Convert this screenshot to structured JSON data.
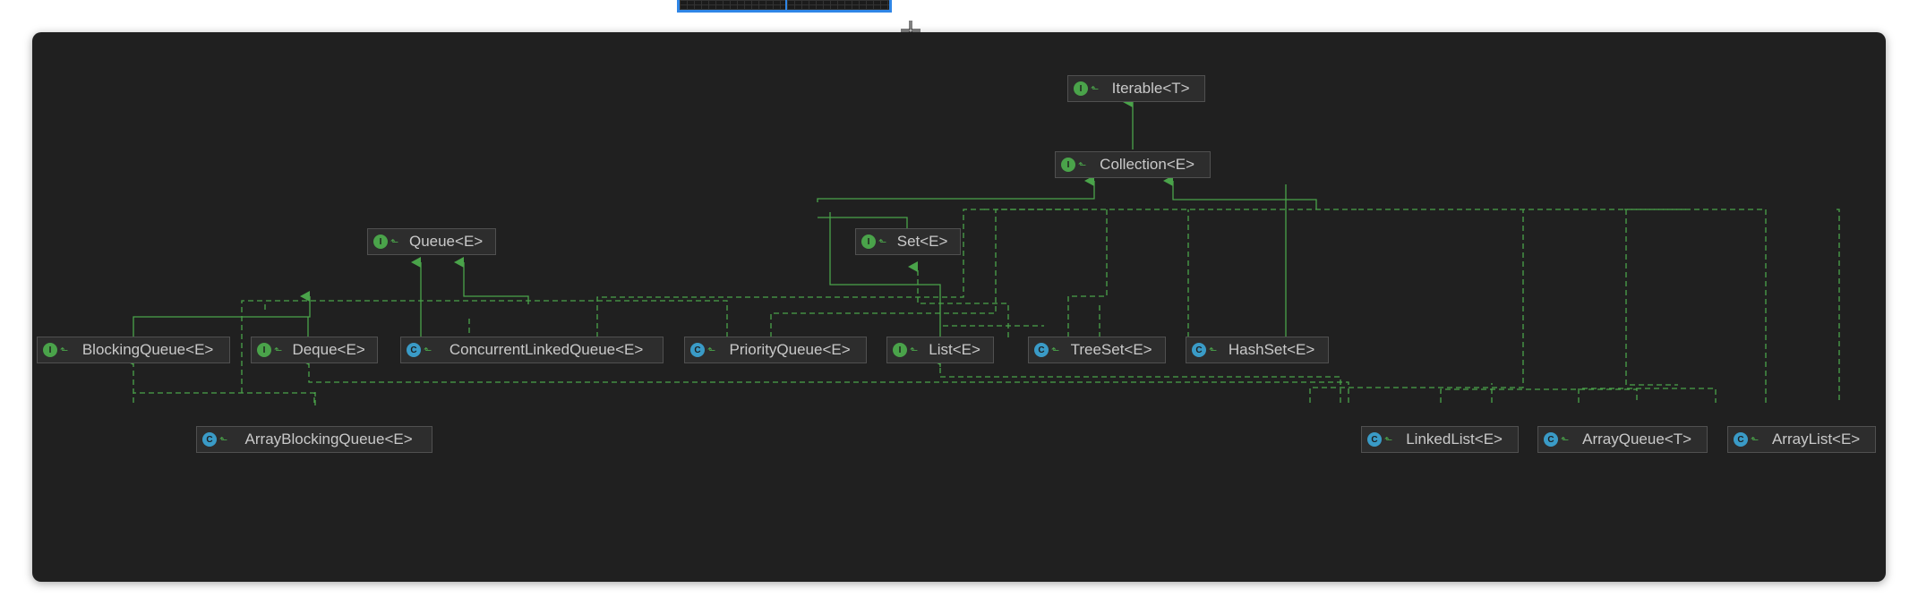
{
  "diagram": {
    "nodes": {
      "iterable": {
        "label": "Iterable<T>",
        "kind": "I"
      },
      "collection": {
        "label": "Collection<E>",
        "kind": "I"
      },
      "queue": {
        "label": "Queue<E>",
        "kind": "I"
      },
      "set": {
        "label": "Set<E>",
        "kind": "I"
      },
      "blockingqueue": {
        "label": "BlockingQueue<E>",
        "kind": "I"
      },
      "deque": {
        "label": "Deque<E>",
        "kind": "I"
      },
      "clq": {
        "label": "ConcurrentLinkedQueue<E>",
        "kind": "C"
      },
      "pq": {
        "label": "PriorityQueue<E>",
        "kind": "C"
      },
      "list": {
        "label": "List<E>",
        "kind": "I"
      },
      "treeset": {
        "label": "TreeSet<E>",
        "kind": "C"
      },
      "hashset": {
        "label": "HashSet<E>",
        "kind": "C"
      },
      "abq": {
        "label": "ArrayBlockingQueue<E>",
        "kind": "C"
      },
      "linkedlist": {
        "label": "LinkedList<E>",
        "kind": "C"
      },
      "arrayqueue": {
        "label": "ArrayQueue<T>",
        "kind": "C"
      },
      "arraylist": {
        "label": "ArrayList<E>",
        "kind": "C"
      }
    },
    "colors": {
      "edge": "#4aa34a",
      "interface_badge": "#4aa34a",
      "class_badge": "#3a9bc7"
    }
  }
}
